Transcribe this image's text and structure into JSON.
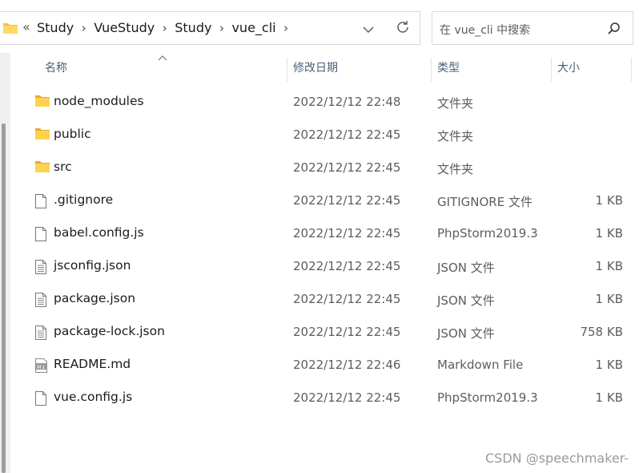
{
  "address_bar": {
    "overflow_chevron": "«",
    "breadcrumbs": [
      "Study",
      "VueStudy",
      "Study",
      "vue_cli"
    ],
    "separator": "›"
  },
  "search": {
    "placeholder": "在 vue_cli 中搜索"
  },
  "columns": {
    "name": "名称",
    "date": "修改日期",
    "type": "类型",
    "size": "大小"
  },
  "files": [
    {
      "name": "node_modules",
      "date": "2022/12/12 22:48",
      "type": "文件夹",
      "size": "",
      "icon": "folder-icon"
    },
    {
      "name": "public",
      "date": "2022/12/12 22:45",
      "type": "文件夹",
      "size": "",
      "icon": "folder-icon"
    },
    {
      "name": "src",
      "date": "2022/12/12 22:45",
      "type": "文件夹",
      "size": "",
      "icon": "folder-icon"
    },
    {
      "name": ".gitignore",
      "date": "2022/12/12 22:45",
      "type": "GITIGNORE 文件",
      "size": "1 KB",
      "icon": "file-icon"
    },
    {
      "name": "babel.config.js",
      "date": "2022/12/12 22:45",
      "type": "PhpStorm2019.3",
      "size": "1 KB",
      "icon": "file-icon"
    },
    {
      "name": "jsconfig.json",
      "date": "2022/12/12 22:45",
      "type": "JSON 文件",
      "size": "1 KB",
      "icon": "text-file-icon"
    },
    {
      "name": "package.json",
      "date": "2022/12/12 22:45",
      "type": "JSON 文件",
      "size": "1 KB",
      "icon": "text-file-icon"
    },
    {
      "name": "package-lock.json",
      "date": "2022/12/12 22:45",
      "type": "JSON 文件",
      "size": "758 KB",
      "icon": "text-file-icon"
    },
    {
      "name": "README.md",
      "date": "2022/12/12 22:46",
      "type": "Markdown File",
      "size": "1 KB",
      "icon": "markdown-file-icon"
    },
    {
      "name": "vue.config.js",
      "date": "2022/12/12 22:45",
      "type": "PhpStorm2019.3",
      "size": "1 KB",
      "icon": "file-icon"
    }
  ],
  "watermark": "CSDN @speechmaker-"
}
